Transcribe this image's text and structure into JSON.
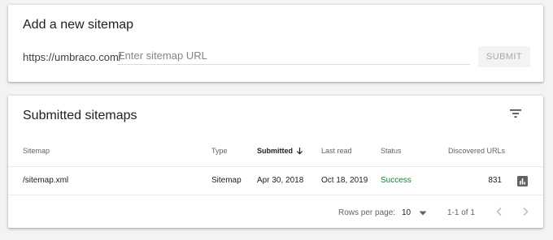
{
  "add_sitemap": {
    "title": "Add a new sitemap",
    "prefix": "https://umbraco.com/",
    "placeholder": "Enter sitemap URL",
    "submit_label": "SUBMIT"
  },
  "submitted": {
    "title": "Submitted sitemaps",
    "filter_icon": "filter-list-icon",
    "columns": {
      "sitemap": "Sitemap",
      "type": "Type",
      "submitted": "Submitted",
      "last_read": "Last read",
      "status": "Status",
      "discovered_urls": "Discovered URLs"
    },
    "sort_icon": "arrow-down-icon",
    "rows": [
      {
        "sitemap": "/sitemap.xml",
        "type": "Sitemap",
        "submitted": "Apr 30, 2018",
        "last_read": "Oct 18, 2019",
        "status": "Success",
        "discovered_urls": "831",
        "action_icon": "bar-chart-icon"
      }
    ],
    "pagination": {
      "rows_per_page_label": "Rows per page:",
      "rows_per_page_value": "10",
      "range": "1-1 of 1"
    }
  },
  "colors": {
    "background": "#f1f3f4",
    "success": "#188038",
    "disabled_text": "#a6a8aa"
  }
}
